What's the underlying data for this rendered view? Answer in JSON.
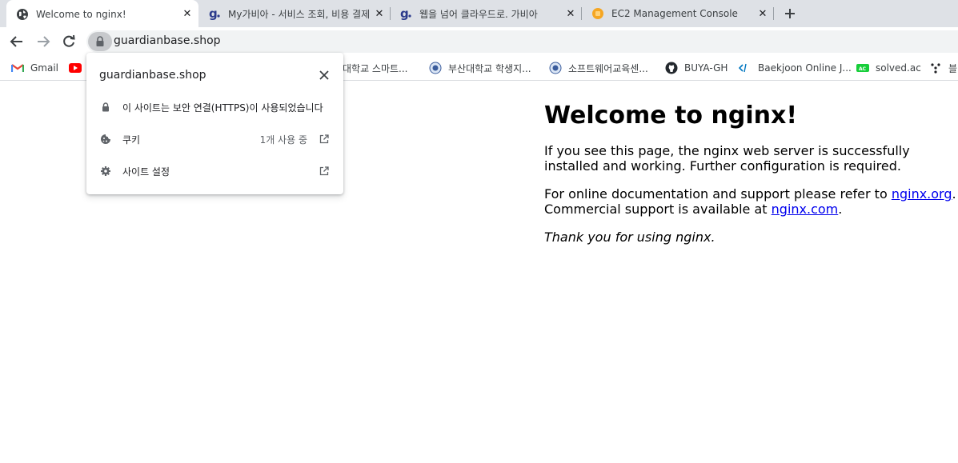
{
  "tabs": [
    {
      "title": "Welcome to nginx!",
      "icon": "globe-icon",
      "active": true
    },
    {
      "title": "My가비아 - 서비스 조회, 비용 결제",
      "icon": "gabia-g-icon",
      "active": false
    },
    {
      "title": "웹을 넘어 클라우드로. 가비아",
      "icon": "gabia-g-icon",
      "active": false
    },
    {
      "title": "EC2 Management Console",
      "icon": "aws-icon",
      "active": false
    }
  ],
  "toolbar": {
    "url": "guardianbase.shop"
  },
  "bookmarks": [
    {
      "label": "Gmail",
      "icon": "gmail-icon"
    },
    {
      "label": "",
      "icon": "youtube-icon"
    },
    {
      "label": "대학교 스마트...",
      "icon": "university-icon"
    },
    {
      "label": "부산대학교 학생지...",
      "icon": "university-seal-icon"
    },
    {
      "label": "소프트웨어교육센...",
      "icon": "university-seal-icon"
    },
    {
      "label": "BUYA-GH",
      "icon": "github-icon"
    },
    {
      "label": "Baekjoon Online J...",
      "icon": "code-icon"
    },
    {
      "label": "solved.ac",
      "icon": "solved-ac-icon"
    },
    {
      "label": "블",
      "icon": "tree-icon"
    }
  ],
  "popup": {
    "host": "guardianbase.shop",
    "connection_text": "이 사이트는 보안 연결(HTTPS)이 사용되었습니다",
    "cookies_label": "쿠키",
    "cookies_value": "1개 사용 중",
    "site_settings_label": "사이트 설정"
  },
  "page": {
    "heading": "Welcome to nginx!",
    "p1": "If you see this page, the nginx web server is successfully installed and working. Further configuration is required.",
    "p2_before": "For online documentation and support please refer to ",
    "p2_link1": "nginx.org",
    "p2_middle": ".\nCommercial support is available at ",
    "p2_link2": "nginx.com",
    "p2_after": ".",
    "p3": "Thank you for using nginx."
  },
  "colors": {
    "tabstrip_bg": "#dee1e6",
    "omnibox_bg": "#f1f3f4",
    "link": "#0000ee",
    "gabia_blue": "#2b3a8c",
    "aws_orange": "#f5a623"
  }
}
